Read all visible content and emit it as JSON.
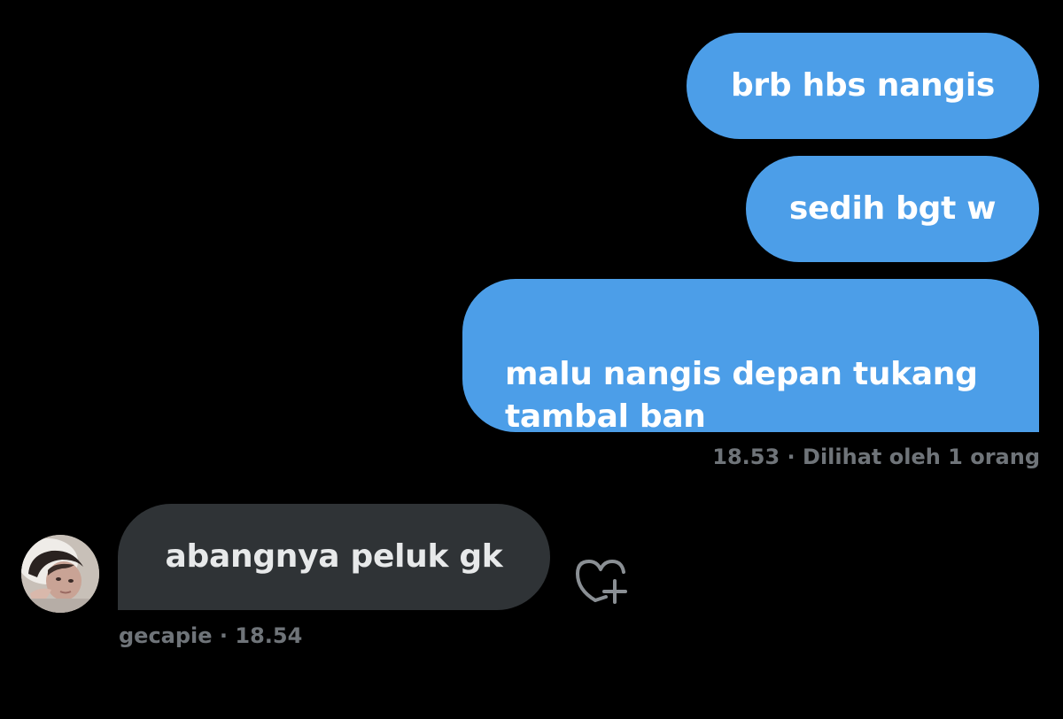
{
  "sent_messages": [
    {
      "text": "brb hbs nangis"
    },
    {
      "text": "sedih bgt w"
    },
    {
      "text": "malu nangis depan tukang\ntambal ban"
    }
  ],
  "sent_meta": {
    "time": "18.53",
    "separator": " · ",
    "seen": "Dilihat oleh 1 orang"
  },
  "received_message": {
    "text": "abangnya peluk gk",
    "sender": "gecapie",
    "separator": " · ",
    "time": "18.54"
  },
  "icons": {
    "avatar": "user-avatar-photo",
    "reaction": "heart-plus-icon"
  },
  "colors": {
    "background": "#000000",
    "sent_bubble": "#4c9ee8",
    "received_bubble": "#2f3336",
    "meta_text": "#6f7479"
  }
}
